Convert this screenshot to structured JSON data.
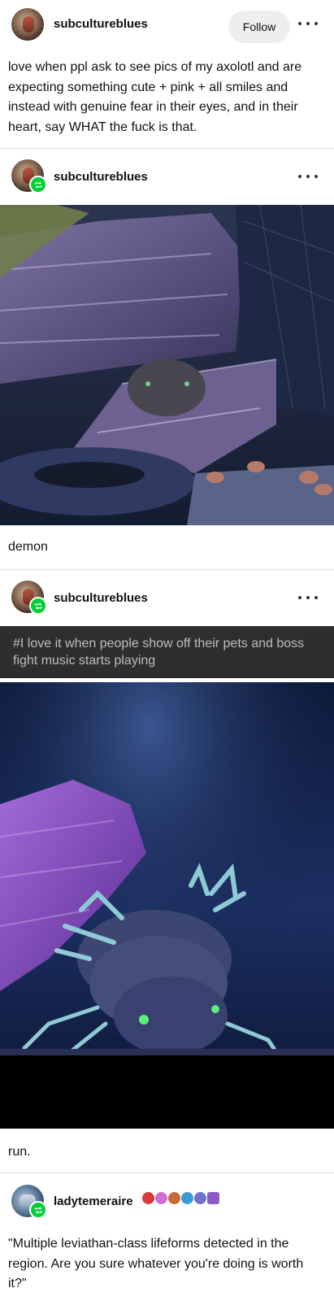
{
  "posts": [
    {
      "username": "subcultureblues",
      "follow_label": "Follow",
      "text": "love when ppl ask to see pics of my axolotl and are expecting something cute + pink + all smiles and instead with genuine fear in their eyes, and in their heart, say WHAT the fuck is that."
    },
    {
      "username": "subcultureblues",
      "caption": "demon"
    },
    {
      "username": "subcultureblues",
      "tag": "#I love it when people show off their pets and boss fight music starts playing",
      "caption": "run."
    },
    {
      "username": "ladytemeraire",
      "badges": [
        "red-badge-icon",
        "pink-face-icon",
        "orange-creature-icon",
        "blue-wave-icon",
        "purple-ghost-icon",
        "purple-tank-icon"
      ],
      "text": "\"Multiple leviathan-class lifeforms detected in the region. Are you sure whatever you're doing is worth it?\""
    }
  ],
  "colors": {
    "reblog_badge": "#00cf35",
    "tag_bar": "#2e2e2e",
    "tag_text": "#bdbdbd"
  }
}
